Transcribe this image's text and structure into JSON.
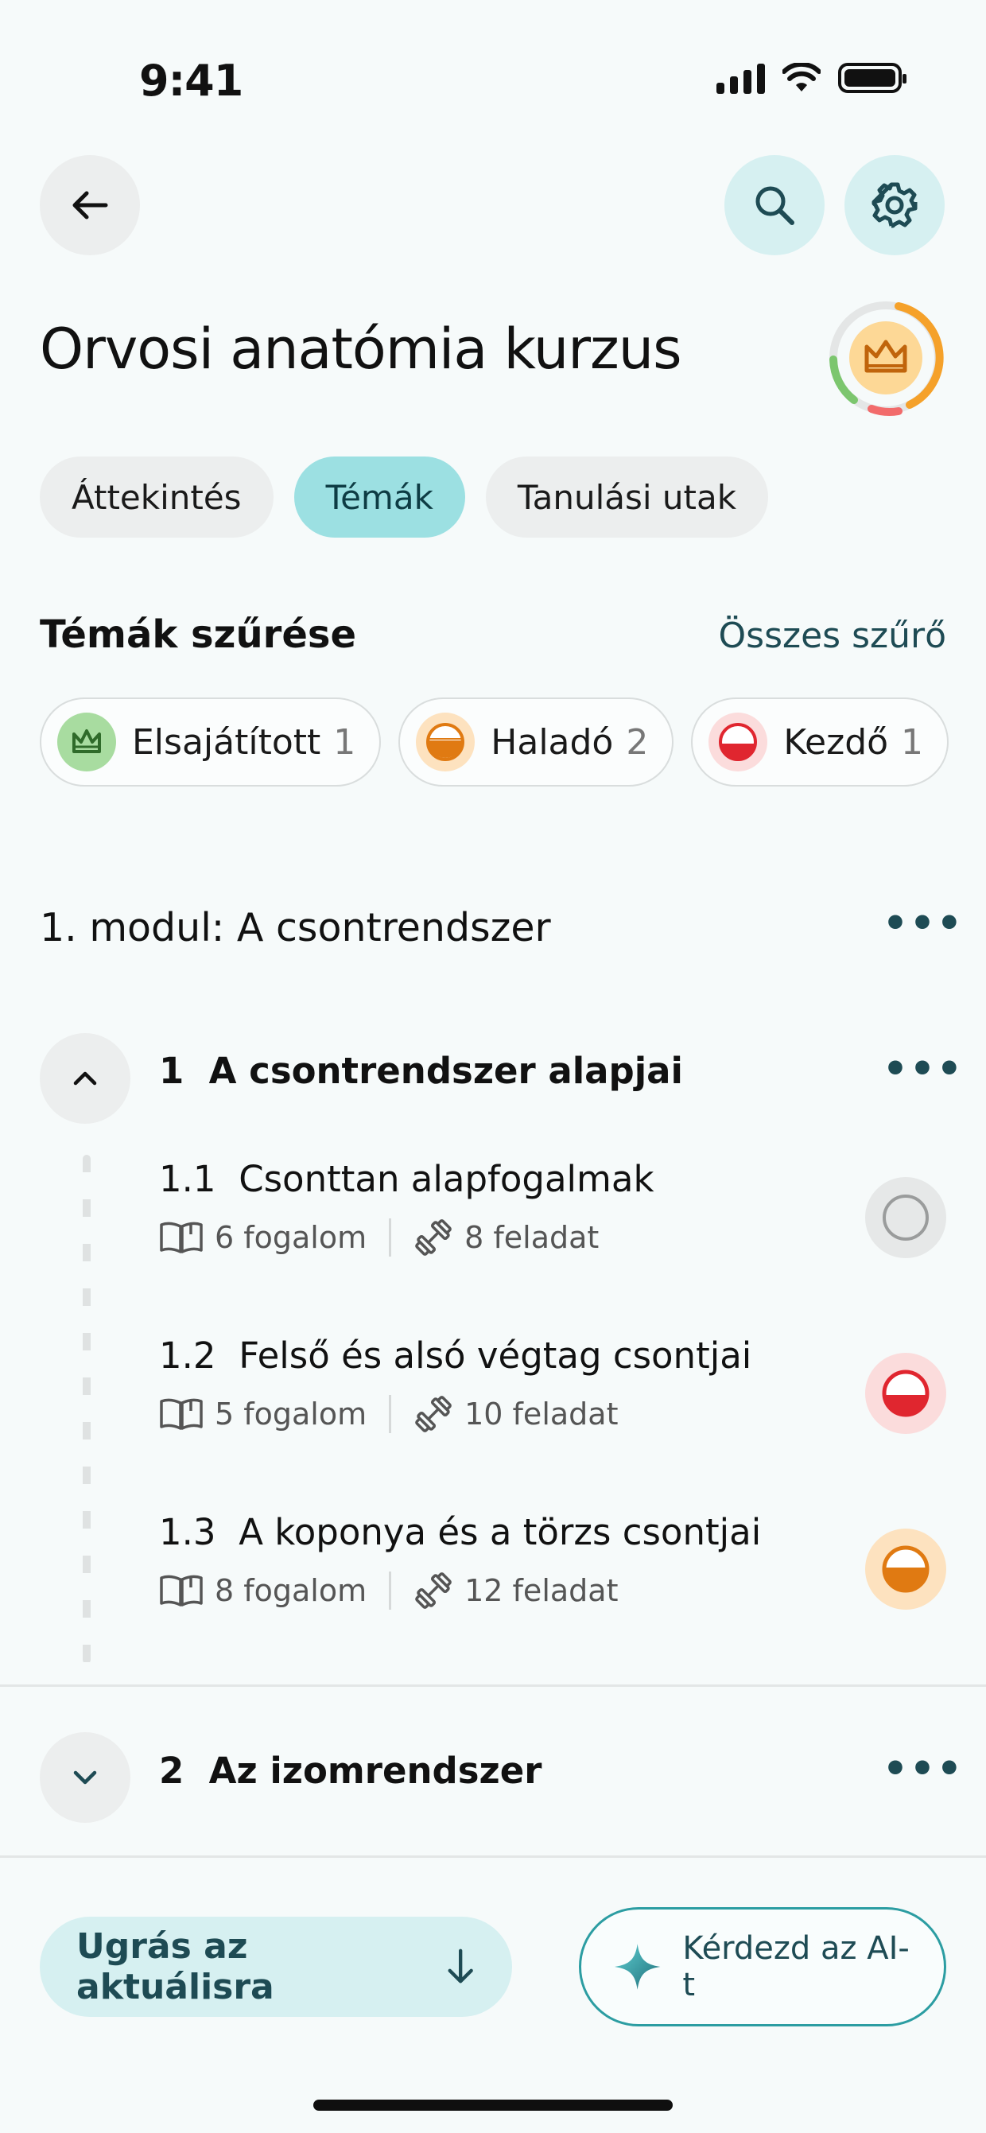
{
  "status_bar": {
    "time": "9:41"
  },
  "header": {
    "title": "Orvosi anatómia kurzus"
  },
  "tabs": [
    {
      "label": "Áttekintés",
      "active": false
    },
    {
      "label": "Témák",
      "active": true
    },
    {
      "label": "Tanulási utak",
      "active": false
    }
  ],
  "filters": {
    "heading": "Témák szűrése",
    "all_filters_label": "Összes szűrő",
    "chips": [
      {
        "label": "Elsajátított",
        "count": "1",
        "icon": "crown-icon",
        "color": "#a8dca0"
      },
      {
        "label": "Haladó",
        "count": "2",
        "icon": "half-filled-orange-icon",
        "color": "#fde2bf"
      },
      {
        "label": "Kezdő",
        "count": "1",
        "icon": "half-filled-red-icon",
        "color": "#fbdcdc"
      }
    ]
  },
  "module": {
    "title": "1. modul: A csontrendszer",
    "sections": [
      {
        "number": "1",
        "title": "A csontrendszer alapjai",
        "expanded": true,
        "lessons": [
          {
            "number": "1.1",
            "title": "Csonttan alapfogalmak",
            "concepts": "6 fogalom",
            "tasks": "8 feladat",
            "status": "not-started"
          },
          {
            "number": "1.2",
            "title": "Felső és alsó végtag csontjai",
            "concepts": "5 fogalom",
            "tasks": "10 feladat",
            "status": "beginner"
          },
          {
            "number": "1.3",
            "title": "A koponya és a törzs csontjai",
            "concepts": "8 fogalom",
            "tasks": "12 feladat",
            "status": "intermediate"
          }
        ]
      },
      {
        "number": "2",
        "title": "Az izomrendszer",
        "expanded": false
      }
    ]
  },
  "bottom": {
    "jump_label": "Ugrás az aktuálisra",
    "ai_label": "Kérdezd az AI-t"
  },
  "colors": {
    "accent": "#9ce0e2",
    "accent_light": "#d6f0f1",
    "dark_teal": "#1e4b54",
    "orange": "#e07a12",
    "red": "#e0262f",
    "green": "#3a8a38"
  }
}
